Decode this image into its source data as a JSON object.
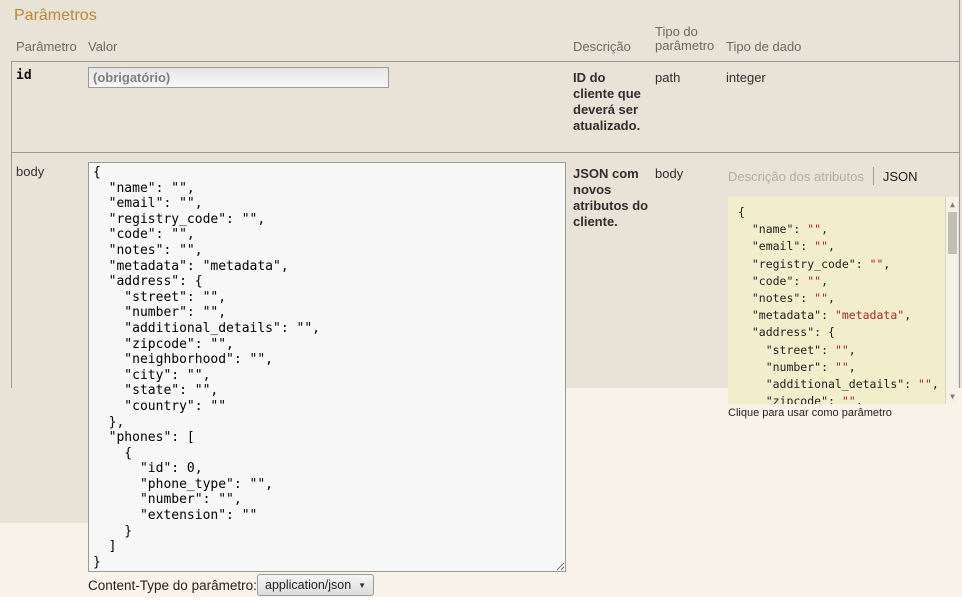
{
  "section_title": "Parâmetros",
  "table": {
    "headers": {
      "parameter": "Parâmetro",
      "value": "Valor",
      "description": "Descrição",
      "parameter_type": "Tipo do parâmetro",
      "data_type": "Tipo de dado"
    }
  },
  "rows": {
    "id": {
      "name": "id",
      "placeholder": "(obrigatório)",
      "value": "",
      "description": "ID do cliente que deverá ser atualizado.",
      "parameter_type": "path",
      "data_type": "integer"
    },
    "body": {
      "name": "body",
      "value": "{\n  \"name\": \"\",\n  \"email\": \"\",\n  \"registry_code\": \"\",\n  \"code\": \"\",\n  \"notes\": \"\",\n  \"metadata\": \"metadata\",\n  \"address\": {\n    \"street\": \"\",\n    \"number\": \"\",\n    \"additional_details\": \"\",\n    \"zipcode\": \"\",\n    \"neighborhood\": \"\",\n    \"city\": \"\",\n    \"state\": \"\",\n    \"country\": \"\"\n  },\n  \"phones\": [\n    {\n      \"id\": 0,\n      \"phone_type\": \"\",\n      \"number\": \"\",\n      \"extension\": \"\"\n    }\n  ]\n}",
      "description": "JSON com novos atributos do cliente.",
      "parameter_type": "body"
    }
  },
  "model_panel": {
    "tabs": {
      "description_tab": "Descrição dos atributos",
      "json_tab": "JSON"
    },
    "hint": "Clique para usar como parâmetro",
    "scrollbar": {
      "up_arrow": "▲",
      "down_arrow": "▼"
    },
    "snippet_lines": [
      {
        "k": "{"
      },
      {
        "k": "  \"name\": ",
        "v": "\"\"",
        "s": ","
      },
      {
        "k": "  \"email\": ",
        "v": "\"\"",
        "s": ","
      },
      {
        "k": "  \"registry_code\": ",
        "v": "\"\"",
        "s": ","
      },
      {
        "k": "  \"code\": ",
        "v": "\"\"",
        "s": ","
      },
      {
        "k": "  \"notes\": ",
        "v": "\"\"",
        "s": ","
      },
      {
        "k": "  \"metadata\": ",
        "v": "\"metadata\"",
        "s": ","
      },
      {
        "k": "  \"address\": {"
      },
      {
        "k": "    \"street\": ",
        "v": "\"\"",
        "s": ","
      },
      {
        "k": "    \"number\": ",
        "v": "\"\"",
        "s": ","
      },
      {
        "k": "    \"additional_details\": ",
        "v": "\"\"",
        "s": ","
      },
      {
        "k": "    \"zipcode\": ",
        "v": "\"\"",
        "s": ","
      }
    ]
  },
  "footer": {
    "content_type_label": "Content-Type do parâmetro:",
    "content_type_value": "application/json",
    "dropdown_arrow": "▼"
  },
  "colors": {
    "row_background": "#e9e2d7",
    "page_background": "#f9f3e9",
    "snippet_background": "#f2edca",
    "heading_accent": "#bc873a",
    "snippet_value_red": "#a52a2a",
    "border_gray": "#999999"
  }
}
